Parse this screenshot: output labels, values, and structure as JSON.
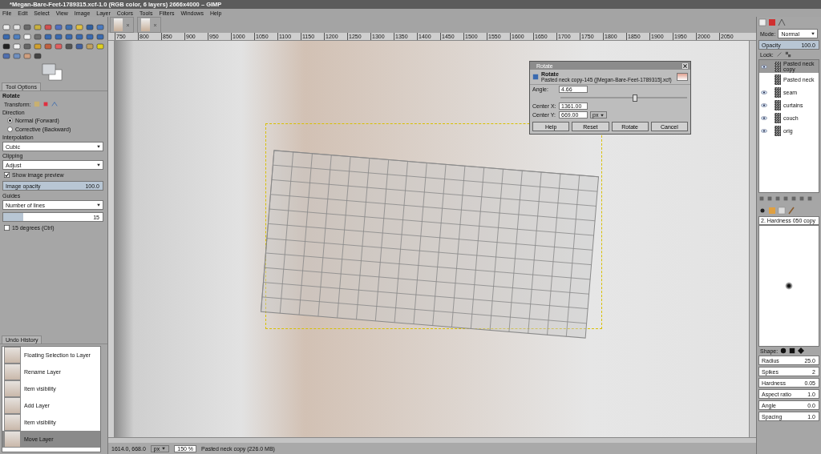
{
  "window": {
    "title": "*Megan-Bare-Feet-1789315.xcf-1.0 (RGB color, 6 layers) 2666x4000 – GIMP"
  },
  "menu": [
    "File",
    "Edit",
    "Select",
    "View",
    "Image",
    "Layer",
    "Colors",
    "Tools",
    "Filters",
    "Windows",
    "Help"
  ],
  "ruler_labels": [
    "750",
    "800",
    "850",
    "900",
    "950",
    "1000",
    "1050",
    "1100",
    "1150",
    "1200",
    "1250",
    "1300",
    "1350",
    "1400",
    "1450",
    "1500",
    "1550",
    "1600",
    "1650",
    "1700",
    "1750",
    "1800",
    "1850",
    "1900",
    "1950",
    "2000",
    "2050"
  ],
  "tool_options": {
    "tab": "Tool Options",
    "title": "Rotate",
    "transform_label": "Transform:",
    "direction_label": "Direction",
    "directions": [
      {
        "label": "Normal (Forward)",
        "selected": true
      },
      {
        "label": "Corrective (Backward)",
        "selected": false
      }
    ],
    "interpolation_label": "Interpolation",
    "interpolation": "Cubic",
    "clipping_label": "Clipping",
    "clipping": "Adjust",
    "preview": {
      "label": "Show image preview",
      "checked": true
    },
    "image_opacity": {
      "label": "Image opacity",
      "value": "100.0",
      "level": 1
    },
    "guides_label": "Guides",
    "guides": "Number of lines",
    "lines": {
      "value": "15",
      "level": 0.2
    },
    "constrain": {
      "label": "15 degrees  (Ctrl)",
      "checked": false
    }
  },
  "undo_history": {
    "tab": "Undo History",
    "items": [
      {
        "label": "Floating Selection to Layer",
        "selected": false
      },
      {
        "label": "Rename Layer",
        "selected": false
      },
      {
        "label": "Item visibility",
        "selected": false
      },
      {
        "label": "Add Layer",
        "selected": false
      },
      {
        "label": "Item visibility",
        "selected": false
      },
      {
        "label": "Move Layer",
        "selected": true
      }
    ]
  },
  "dialog": {
    "title": "Rotate",
    "heading": "Rotate",
    "subtitle": "Pasted neck copy-145 ([Megan-Bare-Feet-1789315].xcf)",
    "angle": {
      "label": "Angle:",
      "value": "4.66",
      "level": 0.58
    },
    "center_x": {
      "label": "Center X:",
      "value": "1361.00"
    },
    "center_y": {
      "label": "Center Y:",
      "value": "669.00"
    },
    "unit": "px",
    "buttons": [
      "Help",
      "Reset",
      "Rotate",
      "Cancel"
    ]
  },
  "status_bar": {
    "coords": "1614.0, 668.0",
    "unit": "px",
    "zoom": "150 %",
    "message": "Pasted neck copy (226.0 MB)"
  },
  "layers": {
    "mode_label": "Mode:",
    "mode": "Normal",
    "opacity": {
      "label": "Opacity",
      "value": "100.0",
      "level": 1
    },
    "lock_label": "Lock:",
    "items": [
      {
        "name": "Pasted neck copy",
        "visible": true,
        "selected": true
      },
      {
        "name": "Pasted neck",
        "visible": false,
        "selected": false
      },
      {
        "name": "seam",
        "visible": true,
        "selected": false
      },
      {
        "name": "curtains",
        "visible": true,
        "selected": false
      },
      {
        "name": "couch",
        "visible": true,
        "selected": false
      },
      {
        "name": "orig",
        "visible": true,
        "selected": false
      }
    ]
  },
  "brushes": {
    "name": "2. Hardness 050 copy",
    "shape_label": "Shape:",
    "params": [
      {
        "label": "Radius",
        "value": "25.0"
      },
      {
        "label": "Spikes",
        "value": "2"
      },
      {
        "label": "Hardness",
        "value": "0.05"
      },
      {
        "label": "Aspect ratio",
        "value": "1.0"
      },
      {
        "label": "Angle",
        "value": "0.0"
      },
      {
        "label": "Spacing",
        "value": "1.0"
      }
    ]
  }
}
